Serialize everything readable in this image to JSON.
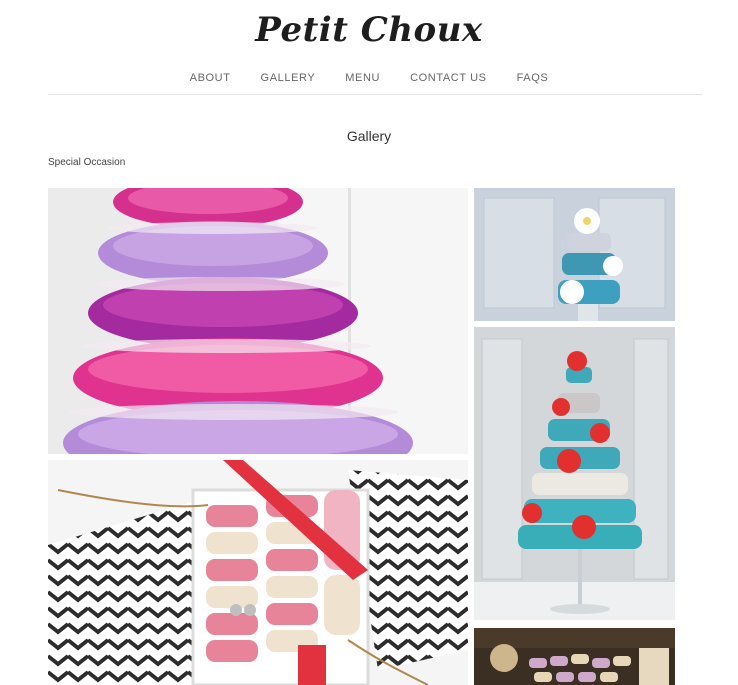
{
  "site": {
    "brand": "Petit Choux"
  },
  "nav": {
    "items": [
      {
        "label": "ABOUT"
      },
      {
        "label": "GALLERY"
      },
      {
        "label": "MENU"
      },
      {
        "label": "CONTACT US"
      },
      {
        "label": "FAQS"
      }
    ]
  },
  "main": {
    "title": "Gallery",
    "section": "Special Occasion"
  },
  "colors": {
    "magenta": "#d6308f",
    "lavender": "#b48bd8",
    "teal": "#3fa9b9",
    "red": "#e2302f",
    "pink": "#e8849a",
    "cream": "#efe2cf"
  }
}
